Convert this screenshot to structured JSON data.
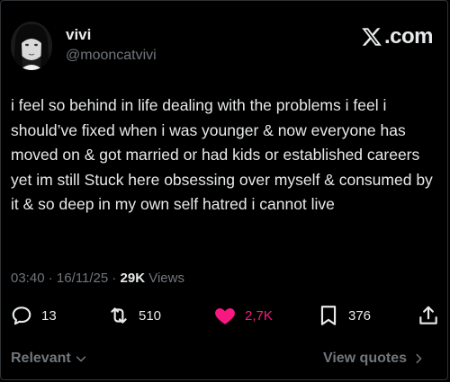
{
  "user": {
    "display_name": "vivi",
    "handle": "@mooncatvivi"
  },
  "brand": {
    "label": ".com",
    "icon": "x-logo-icon"
  },
  "tweet": {
    "text": "i feel so behind in life dealing with the problems i feel i should’ve fixed when i was younger & now everyone has moved on & got married or had kids or established careers yet im still Stuck here obsessing over myself & consumed by it & so deep in my own self hatred i cannot live"
  },
  "meta": {
    "time": "03:40",
    "separator": " · ",
    "date": "16/11/25",
    "views_count": "29K",
    "views_label": " Views"
  },
  "actions": {
    "reply": {
      "count": "13",
      "icon": "reply-icon"
    },
    "repost": {
      "count": "510",
      "icon": "repost-icon"
    },
    "like": {
      "count": "2,7K",
      "icon": "heart-icon",
      "color": "#f91880"
    },
    "bookmark": {
      "count": "376",
      "icon": "bookmark-icon"
    },
    "share": {
      "icon": "share-icon"
    }
  },
  "footer": {
    "sort_label": "Relevant",
    "quotes_label": "View quotes"
  },
  "colors": {
    "background": "#000000",
    "text": "#e7e9ea",
    "muted": "#71767b",
    "like": "#f91880"
  }
}
